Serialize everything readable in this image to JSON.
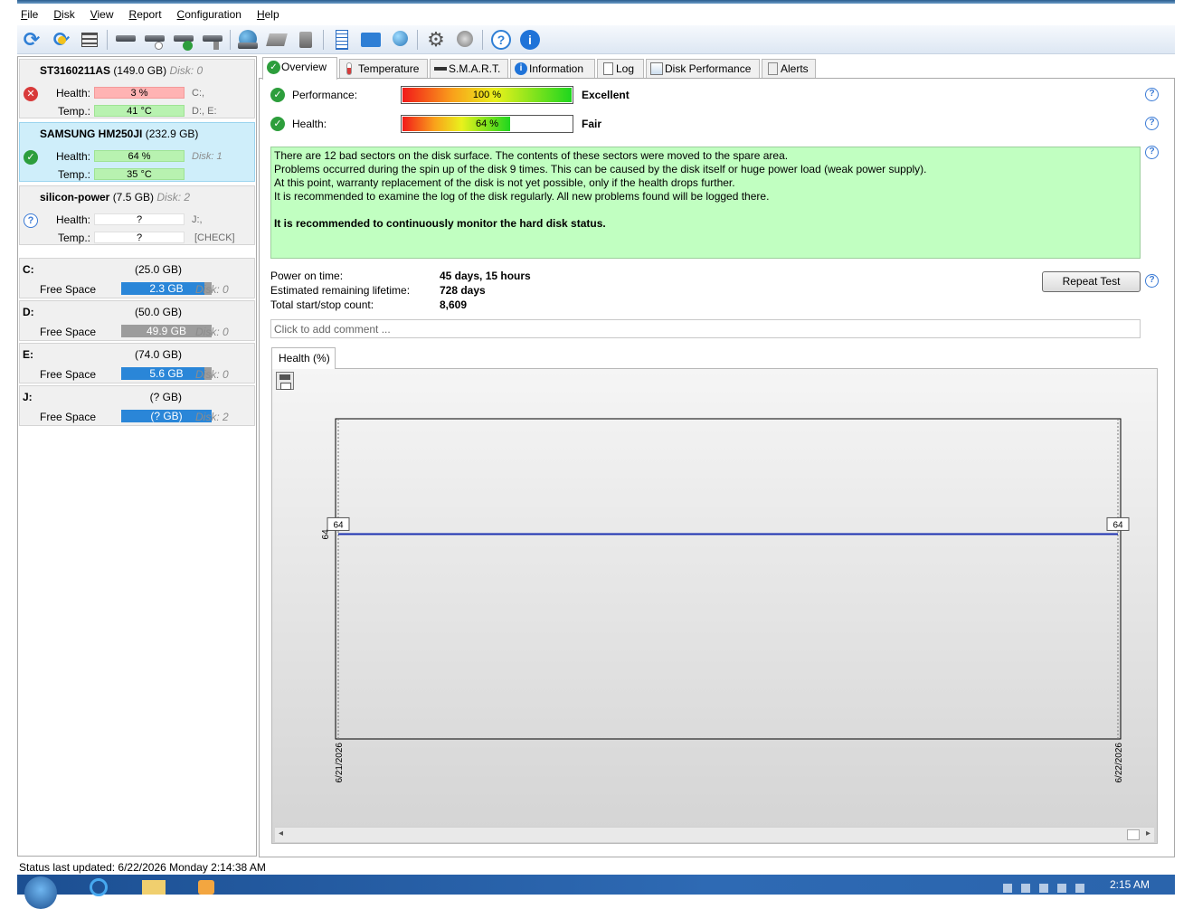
{
  "menu": [
    "File",
    "Disk",
    "View",
    "Report",
    "Configuration",
    "Help"
  ],
  "toolbar": {
    "icons": [
      "refresh-icon",
      "refresh-warning-icon",
      "disk-list-icon",
      "disk-icon",
      "disk-schedule-icon",
      "disk-check-icon",
      "disk-test-icon",
      "globe-disk-icon",
      "disk-stack-icon",
      "disk-user-icon",
      "notes-icon",
      "email-icon",
      "network-icon",
      "settings-icon",
      "speaker-icon",
      "help-icon",
      "info-icon"
    ]
  },
  "disks": [
    {
      "name": "ST3160211AS",
      "size": "(149.0 GB)",
      "disk": "Disk: 0",
      "health_label": "Health:",
      "health": "3 %",
      "health_state": "bad",
      "temp_label": "Temp.:",
      "temp": "41 °C",
      "aux1": "C:,",
      "aux2": "D:, E:"
    },
    {
      "name": "SAMSUNG HM250JI",
      "size": "(232.9 GB)",
      "disk": "",
      "health_label": "Health:",
      "health": "64 %",
      "health_state": "ok",
      "temp_label": "Temp.:",
      "temp": "35 °C",
      "aux1": "Disk: 1",
      "aux2": ""
    },
    {
      "name": "silicon-power",
      "size": "(7.5 GB)",
      "disk": "Disk: 2",
      "health_label": "Health:",
      "health": "?",
      "health_state": "unknown",
      "temp_label": "Temp.:",
      "temp": "?",
      "aux1": "J:,",
      "aux2": "[CHECK]"
    }
  ],
  "volumes": [
    {
      "letter": "C:",
      "size": "(25.0 GB)",
      "free_label": "Free Space",
      "free": "2.3 GB",
      "fill": 0.92,
      "disk": "Disk: 0"
    },
    {
      "letter": "D:",
      "size": "(50.0 GB)",
      "free_label": "Free Space",
      "free": "49.9 GB",
      "fill": 0.0,
      "disk": "Disk: 0"
    },
    {
      "letter": "E:",
      "size": "(74.0 GB)",
      "free_label": "Free Space",
      "free": "5.6 GB",
      "fill": 0.92,
      "disk": "Disk: 0"
    },
    {
      "letter": "J:",
      "size": "(? GB)",
      "free_label": "Free Space",
      "free": "(? GB)",
      "fill": 1.0,
      "disk": "Disk: 2"
    }
  ],
  "tabs": [
    "Overview",
    "Temperature",
    "S.M.A.R.T.",
    "Information",
    "Log",
    "Disk Performance",
    "Alerts"
  ],
  "overview": {
    "performance_label": "Performance:",
    "performance_value": "100 %",
    "performance_level": 1.0,
    "performance_rating": "Excellent",
    "health_label": "Health:",
    "health_value": "64 %",
    "health_level": 0.64,
    "health_rating": "Fair",
    "messages": [
      "There are 12 bad sectors on the disk surface. The contents of these sectors were moved to the spare area.",
      "Problems occurred during the spin up of the disk 9 times. This can be caused by the disk itself or huge power load (weak power supply).",
      "At this point, warranty replacement of the disk is not yet possible, only if the health drops further.",
      "It is recommended to examine the log of the disk regularly. All new problems found will be logged there."
    ],
    "recommendation": "It is recommended to continuously monitor the hard disk status.",
    "power_on_label": "Power on time:",
    "power_on_value": "45 days, 15 hours",
    "lifetime_label": "Estimated remaining lifetime:",
    "lifetime_value": "728 days",
    "startstop_label": "Total start/stop count:",
    "startstop_value": "8,609",
    "repeat_button": "Repeat Test",
    "comment_placeholder": "Click to add comment ..."
  },
  "chart_tab": "Health (%)",
  "chart_data": {
    "type": "line",
    "x": [
      "6/21/2026",
      "6/22/2026"
    ],
    "series": [
      {
        "values": [
          64,
          64
        ]
      }
    ],
    "y_tick": "64",
    "data_labels": [
      "64",
      "64"
    ],
    "color": "#1a2fb0"
  },
  "status": "Status last updated: 6/22/2026 Monday 2:14:38 AM",
  "clock": "2:15 AM"
}
